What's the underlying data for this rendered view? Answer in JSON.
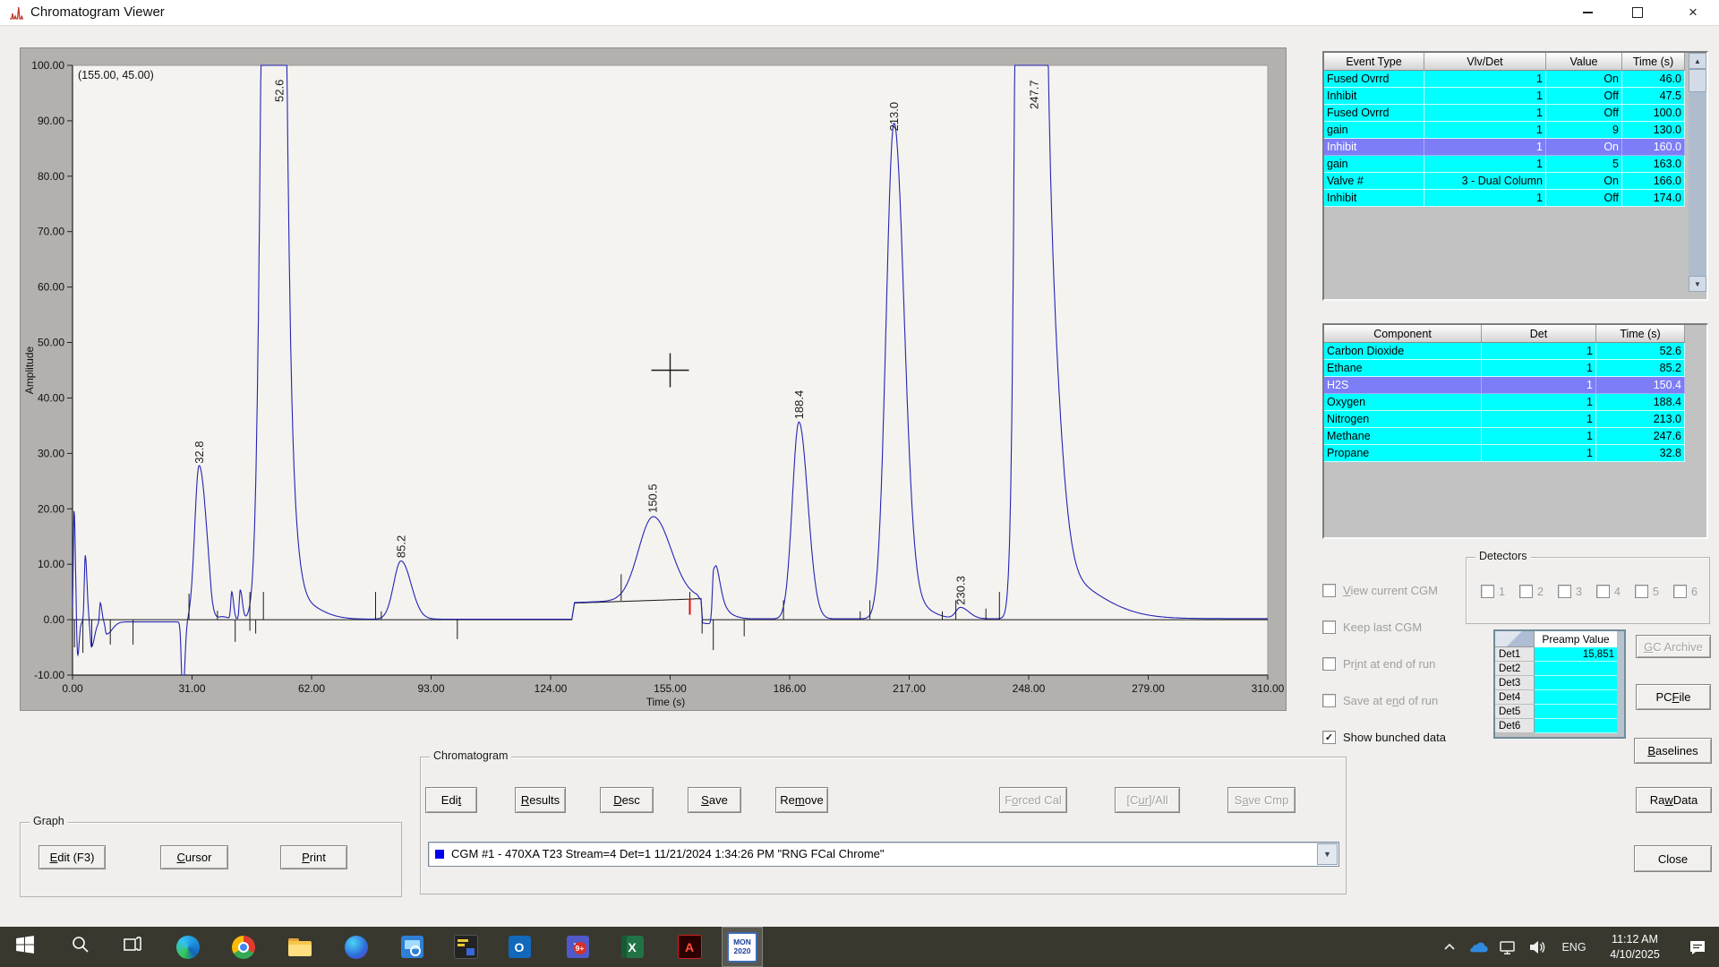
{
  "window": {
    "title": "Chromatogram Viewer"
  },
  "chart_data": {
    "type": "line",
    "title": "",
    "xlabel": "Time (s)",
    "ylabel": "Amplitude",
    "xlim": [
      0,
      310
    ],
    "ylim": [
      -10,
      100
    ],
    "x_ticks": [
      0,
      31,
      62,
      93,
      124,
      155,
      186,
      217,
      248,
      279,
      310
    ],
    "y_ticks": [
      100,
      90,
      80,
      70,
      60,
      50,
      40,
      30,
      20,
      10,
      0,
      -10
    ],
    "grid": false,
    "cursor": {
      "x": 155,
      "y": 45,
      "label": "(155.00, 45.00)"
    },
    "labeled_peaks": [
      {
        "label": "32.8",
        "component": "Propane",
        "time": 32.8,
        "apex": 27.5,
        "clipped": false
      },
      {
        "label": "52.6",
        "component": "Carbon Dioxide",
        "time": 52.6,
        "apex": 100,
        "clipped": true,
        "lx": 53.6,
        "ly": 60
      },
      {
        "label": "85.2",
        "component": "Ethane",
        "time": 85.2,
        "apex": 10.5,
        "clipped": false
      },
      {
        "label": "150.5",
        "component": "H2S",
        "time": 150.5,
        "apex": 18.6,
        "clipped": false
      },
      {
        "label": "188.4",
        "component": "Oxygen",
        "time": 188.4,
        "apex": 35.5,
        "clipped": false
      },
      {
        "label": "213.0",
        "component": "Nitrogen",
        "time": 213.0,
        "apex": 87.5,
        "clipped": false
      },
      {
        "label": "230.3",
        "component": "",
        "time": 230.3,
        "apex": 2.0,
        "clipped": false
      },
      {
        "label": "247.7",
        "component": "Methane",
        "time": 247.7,
        "apex": 100,
        "clipped": true,
        "lx": 249.4,
        "ly": 68
      }
    ],
    "trace_peaks": [
      [
        0.4,
        20,
        0.2,
        0.35
      ],
      [
        1.3,
        -6.5,
        0.25,
        0.4
      ],
      [
        3.3,
        12,
        0.25,
        0.45
      ],
      [
        4.9,
        -4.5,
        0.3,
        0.8
      ],
      [
        7.2,
        3.5,
        0.2,
        0.4
      ],
      [
        8.8,
        -2.2,
        0.3,
        1.5
      ],
      [
        28.6,
        -14,
        0.35,
        0.5
      ],
      [
        32.8,
        27.5,
        1.1,
        1.8
      ],
      [
        34.8,
        1.5,
        1,
        3
      ],
      [
        36.3,
        -2.4,
        0.5,
        1.2
      ],
      [
        41.3,
        4.8,
        0.25,
        0.45
      ],
      [
        43.5,
        5.2,
        0.25,
        0.55
      ],
      [
        52.0,
        400,
        1.9,
        2.0
      ],
      [
        55.8,
        18,
        1.4,
        2.2
      ],
      [
        56.5,
        4,
        1.5,
        6
      ],
      [
        85.2,
        10.5,
        1.9,
        2.6
      ],
      [
        150.6,
        15,
        3.8,
        4.6
      ],
      [
        166.3,
        9.5,
        0.35,
        1.5
      ],
      [
        167.2,
        1.8,
        0.5,
        3
      ],
      [
        188.4,
        35.5,
        1.7,
        2.3
      ],
      [
        213.0,
        87.5,
        2.0,
        2.6
      ],
      [
        215.5,
        4,
        2,
        5
      ],
      [
        230.3,
        2.0,
        1.2,
        2.2
      ],
      [
        247.5,
        700,
        1.6,
        2.2
      ],
      [
        251.5,
        70,
        2,
        3.5
      ],
      [
        251.5,
        9,
        2,
        12
      ]
    ],
    "baseline_offset": [
      [
        0,
        0
      ],
      [
        129.5,
        0
      ],
      [
        130.2,
        3.0
      ],
      [
        159.8,
        3.7
      ],
      [
        163.0,
        3.8
      ],
      [
        163.4,
        0
      ],
      [
        310,
        0
      ]
    ],
    "blue_bias": [
      [
        0,
        -0.4
      ],
      [
        29,
        -0.4
      ],
      [
        31,
        0.1
      ],
      [
        162,
        0.1
      ],
      [
        163.3,
        -0.9
      ],
      [
        166,
        -0.8
      ],
      [
        170,
        0.15
      ],
      [
        310,
        0.2
      ]
    ],
    "event_markers": [
      [
        0.5,
        0,
        -5
      ],
      [
        2.7,
        0,
        -6
      ],
      [
        5,
        0,
        -5
      ],
      [
        9.8,
        0,
        -4.5
      ],
      [
        15.7,
        0,
        -4.5
      ],
      [
        30.2,
        4.7,
        0
      ],
      [
        37.6,
        1.6,
        0
      ],
      [
        42.2,
        0,
        -4
      ],
      [
        46,
        5,
        -2
      ],
      [
        47.5,
        0,
        -2.5
      ],
      [
        49.5,
        5,
        0
      ],
      [
        78.6,
        5,
        0
      ],
      [
        80.1,
        1.5,
        0
      ],
      [
        99.8,
        0,
        -3.5
      ],
      [
        142.3,
        8.2,
        3.4
      ],
      [
        160.1,
        5,
        3.8
      ],
      [
        163.3,
        0,
        -2.5
      ],
      [
        166.2,
        0,
        -5.5
      ],
      [
        174.2,
        0,
        -3
      ],
      [
        184.4,
        3.5,
        0
      ],
      [
        204.3,
        1.5,
        0
      ],
      [
        206.8,
        3.5,
        0
      ],
      [
        225.6,
        1.5,
        0
      ],
      [
        229.1,
        3.5,
        0
      ],
      [
        236.9,
        2,
        0
      ],
      [
        240.4,
        5,
        0
      ]
    ],
    "red_markers": [
      [
        160.1,
        3.8,
        0.9
      ]
    ],
    "colors": {
      "trace": "#2424b4",
      "baseline": "#141414",
      "marker": "#1c1c1c",
      "red": "#e01010",
      "plot_bg": "#f4f3f0",
      "panel_bg": "#b3b1ae"
    }
  },
  "event_table": {
    "headers": [
      "Event Type",
      "Vlv/Det",
      "Value",
      "Time (s)"
    ],
    "rows": [
      [
        "Fused Ovrrd",
        "1",
        "On",
        "46.0"
      ],
      [
        "Inhibit",
        "1",
        "Off",
        "47.5"
      ],
      [
        "Fused Ovrrd",
        "1",
        "Off",
        "100.0"
      ],
      [
        "gain",
        "1",
        "9",
        "130.0"
      ],
      [
        "Inhibit",
        "1",
        "On",
        "160.0"
      ],
      [
        "gain",
        "1",
        "5",
        "163.0"
      ],
      [
        "Valve #",
        "3 - Dual Column",
        "On",
        "166.0"
      ],
      [
        "Inhibit",
        "1",
        "Off",
        "174.0"
      ]
    ],
    "selected_row": 4
  },
  "component_table": {
    "headers": [
      "Component",
      "Det",
      "Time (s)"
    ],
    "rows": [
      [
        "Carbon Dioxide",
        "1",
        "52.6"
      ],
      [
        "Ethane",
        "1",
        "85.2"
      ],
      [
        "H2S",
        "1",
        "150.4"
      ],
      [
        "Oxygen",
        "1",
        "188.4"
      ],
      [
        "Nitrogen",
        "1",
        "213.0"
      ],
      [
        "Methane",
        "1",
        "247.6"
      ],
      [
        "Propane",
        "1",
        "32.8"
      ]
    ],
    "selected_row": 2
  },
  "option_checkboxes": [
    {
      "t": "View current CGM",
      "u": 0,
      "checked": false,
      "enabled": false
    },
    {
      "t": "Keep last CGM",
      "u": -1,
      "checked": false,
      "enabled": false
    },
    {
      "t": "Print at end of run",
      "u": 2,
      "checked": false,
      "enabled": false
    },
    {
      "t": "Save at end of run",
      "u": 9,
      "checked": false,
      "enabled": false
    },
    {
      "t": "Show bunched data",
      "u": -1,
      "checked": true,
      "enabled": true
    }
  ],
  "detectors": {
    "label": "Detectors",
    "items": [
      "1",
      "2",
      "3",
      "4",
      "5",
      "6"
    ]
  },
  "preamp": {
    "header": "Preamp Value",
    "rows": [
      [
        "Det1",
        "15,851"
      ],
      [
        "Det2",
        ""
      ],
      [
        "Det3",
        ""
      ],
      [
        "Det4",
        ""
      ],
      [
        "Det5",
        ""
      ],
      [
        "Det6",
        ""
      ]
    ]
  },
  "side_buttons": [
    {
      "t": "GC Archive",
      "u": 0,
      "enabled": false
    },
    {
      "t": "PC File",
      "u": 3,
      "enabled": true
    },
    {
      "t": "Baselines",
      "u": 0,
      "enabled": true
    },
    {
      "t": "Raw Data",
      "u": 2,
      "enabled": true
    },
    {
      "t": "Close",
      "u": -1,
      "enabled": true
    }
  ],
  "chromatogram_group": {
    "label": "Chromatogram",
    "buttons": [
      {
        "t": "Edit",
        "u": 3,
        "enabled": true
      },
      {
        "t": "Results",
        "u": 0,
        "enabled": true
      },
      {
        "t": "Desc",
        "u": 0,
        "enabled": true
      },
      {
        "t": "Save",
        "u": 0,
        "enabled": true
      },
      {
        "t": "Remove",
        "u": 2,
        "enabled": true
      },
      {
        "t": "Forced Cal",
        "u": 1,
        "enabled": false
      },
      {
        "t": "[Cur]/All",
        "u": 2,
        "ul": 2,
        "enabled": false
      },
      {
        "t": "Save Cmp",
        "u": 1,
        "enabled": false
      }
    ],
    "dropdown": {
      "text": "CGM #1 - 470XA T23 Stream=4 Det=1 11/21/2024 1:34:26 PM \"RNG FCal Chrome\""
    }
  },
  "graph_group": {
    "label": "Graph",
    "buttons": [
      {
        "t": "Edit (F3)",
        "u": 0,
        "enabled": true
      },
      {
        "t": "Cursor",
        "u": 0,
        "enabled": true
      },
      {
        "t": "Print",
        "u": 0,
        "enabled": true
      }
    ]
  },
  "taskbar": {
    "items": [
      {
        "name": "start"
      },
      {
        "name": "search"
      },
      {
        "name": "task-view"
      },
      {
        "name": "edge"
      },
      {
        "name": "chrome"
      },
      {
        "name": "file-explorer"
      },
      {
        "name": "webex"
      },
      {
        "name": "remote-desktop"
      },
      {
        "name": "terminal"
      },
      {
        "name": "outlook"
      },
      {
        "name": "teams",
        "badge": "9+"
      },
      {
        "name": "excel"
      },
      {
        "name": "acrobat"
      },
      {
        "name": "mon-2020",
        "label": "MON 2020",
        "active": true
      }
    ],
    "tray": {
      "lang": "ENG",
      "time": "11:12 AM",
      "date": "4/10/2025"
    }
  }
}
